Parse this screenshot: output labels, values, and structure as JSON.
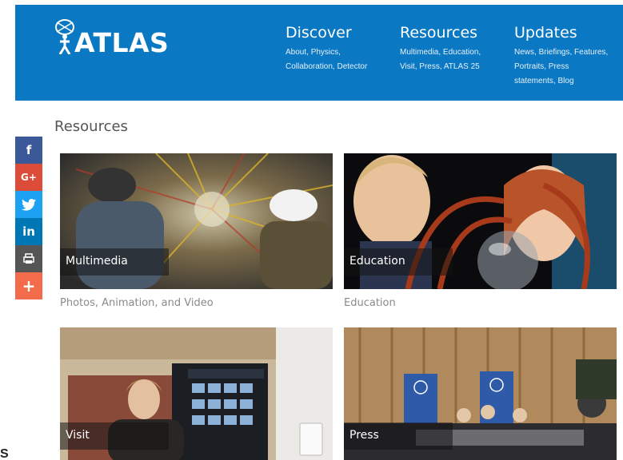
{
  "header": {
    "logo_text": "ATLAS",
    "brand_color": "#0a78c2",
    "nav": [
      {
        "title": "Discover",
        "links": [
          "About,",
          "Physics,",
          "Collaboration,",
          "Detector"
        ]
      },
      {
        "title": "Resources",
        "links": [
          "Multimedia,",
          "Education,",
          "Visit,",
          "Press,",
          "ATLAS 25"
        ]
      },
      {
        "title": "Updates",
        "links": [
          "News,",
          "Briefings,",
          "Features,",
          "Portraits,",
          "Press",
          "statements,",
          "Blog"
        ]
      }
    ]
  },
  "social": [
    {
      "icon": "facebook-icon",
      "glyph": "f",
      "color": "#3b5998"
    },
    {
      "icon": "google-plus-icon",
      "glyph": "G+",
      "color": "#dd4b39"
    },
    {
      "icon": "twitter-icon",
      "glyph": "🐦",
      "color": "#1da1f2"
    },
    {
      "icon": "linkedin-icon",
      "glyph": "in",
      "color": "#0077b5"
    },
    {
      "icon": "print-icon",
      "glyph": "⎙",
      "color": "#555555"
    },
    {
      "icon": "more-icon",
      "glyph": "+",
      "color": "#f26b4a"
    }
  ],
  "page_title": "Resources",
  "tiles": [
    {
      "label": "Multimedia",
      "caption": "Photos, Animation, and Video"
    },
    {
      "label": "Education",
      "caption": "Education"
    },
    {
      "label": "Visit",
      "caption": ""
    },
    {
      "label": "Press",
      "caption": ""
    }
  ],
  "bottom_fragment": "S"
}
